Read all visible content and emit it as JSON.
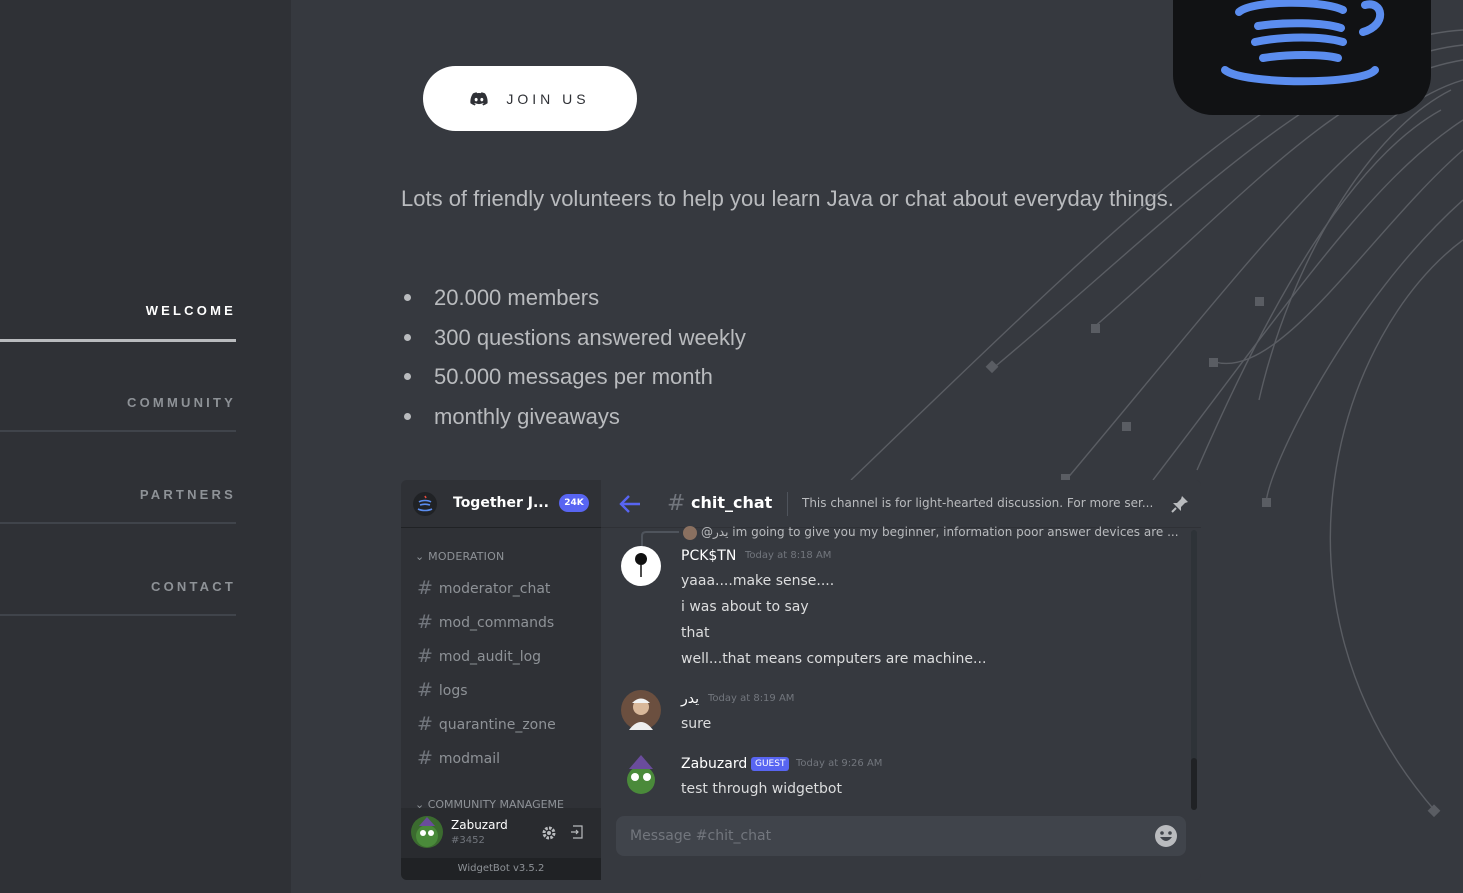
{
  "nav": {
    "items": [
      {
        "label": "WELCOME",
        "active": true
      },
      {
        "label": "COMMUNITY",
        "active": false
      },
      {
        "label": "PARTNERS",
        "active": false
      },
      {
        "label": "CONTACT",
        "active": false
      }
    ]
  },
  "hero": {
    "join_label": "JOIN US",
    "intro": "Lots of friendly volunteers to help you learn Java or chat about everyday things.",
    "stats": [
      "20.000 members",
      "300 questions answered weekly",
      "50.000 messages per month",
      "monthly giveaways"
    ]
  },
  "colors": {
    "accent": "#5865f2",
    "logo_blue": "#5b8def",
    "logo_red": "#e84b3c"
  },
  "widget": {
    "server_name": "Together J...",
    "member_count": "24K",
    "category_moderation": "MODERATION",
    "channels": [
      "moderator_chat",
      "mod_commands",
      "mod_audit_log",
      "logs",
      "quarantine_zone",
      "modmail"
    ],
    "category_community": "COMMUNITY MANAGEME",
    "user": {
      "name": "Zabuzard",
      "tag": "#3452"
    },
    "version": "WidgetBot v3.5.2",
    "channel": {
      "hash": "#",
      "name": "chit_chat",
      "topic": "This channel is for light-hearted discussion. For more ser..."
    },
    "reply_preview": "@يدر im going to give you my beginner, information poor answer devices are ...",
    "messages": [
      {
        "author": "PCK$TN",
        "time": "Today at 8:18 AM",
        "lines": [
          "yaaa....make sense....",
          "i was about to say",
          "that",
          "well...that means computers are machine..."
        ]
      },
      {
        "author": "يدر",
        "time": "Today at 8:19 AM",
        "lines": [
          "sure"
        ]
      },
      {
        "author": "Zabuzard",
        "badge": "GUEST",
        "time": "Today at 9:26 AM",
        "lines": [
          "test through widgetbot"
        ]
      }
    ],
    "composer_placeholder": "Message #chit_chat"
  }
}
